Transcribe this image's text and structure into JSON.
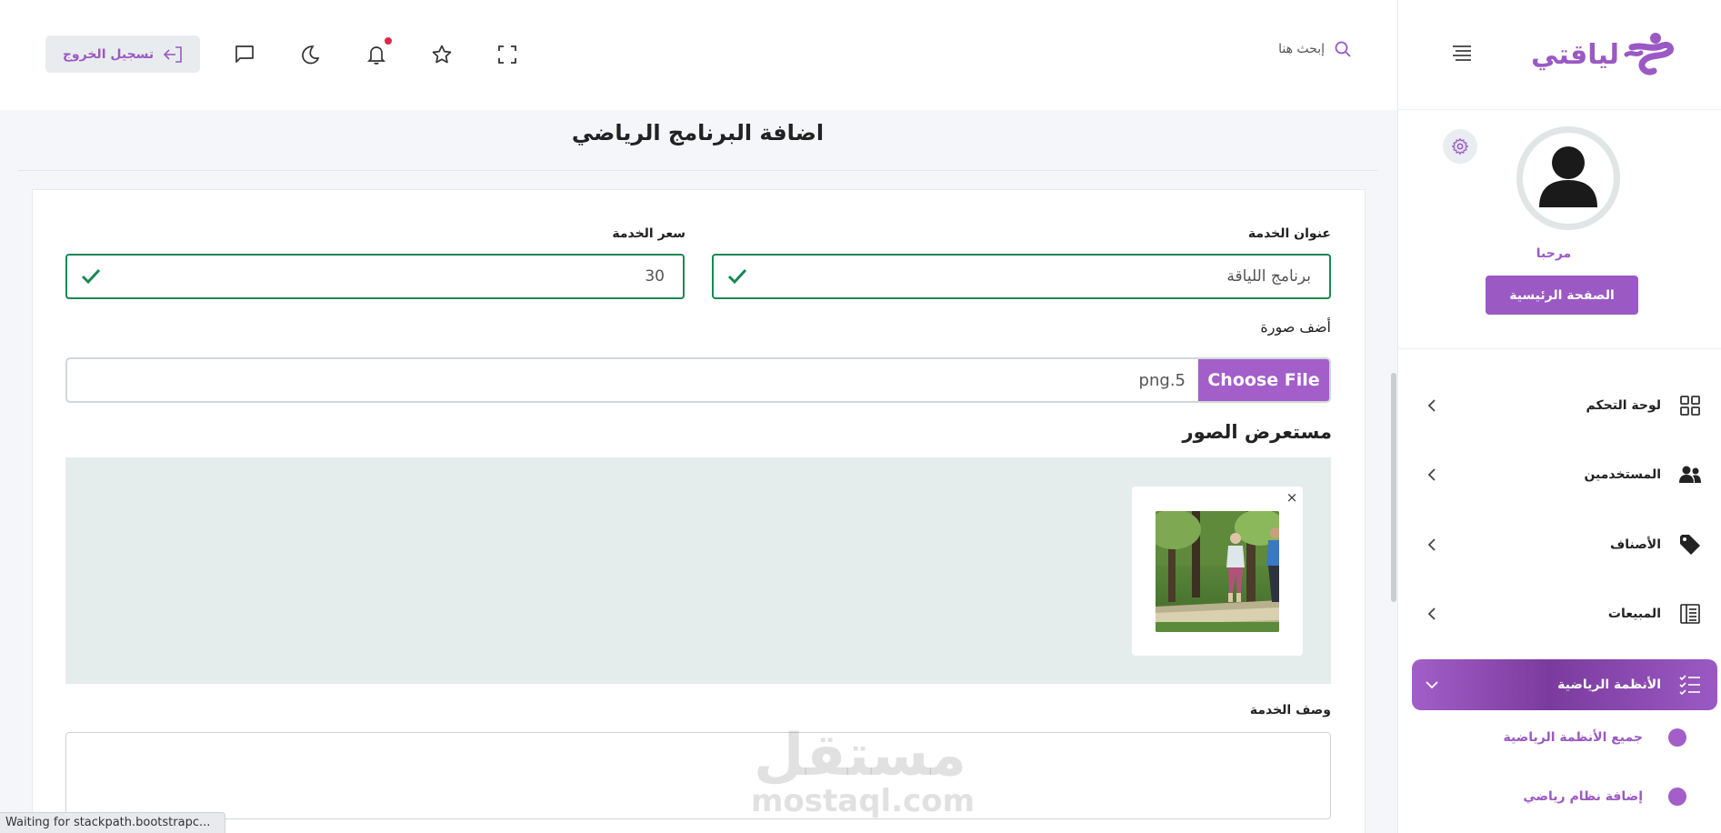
{
  "brand": {
    "name": "لياقتي",
    "color": "#9b59c4"
  },
  "header": {
    "search_placeholder": "إبحث هنا",
    "logout_label": "تسجيل الخروج",
    "icons": [
      "fullscreen-icon",
      "star-icon",
      "bell-icon",
      "moon-icon",
      "message-icon"
    ]
  },
  "profile": {
    "welcome": "مرحبا",
    "home_button": "الصفحة الرئيسية"
  },
  "sidebar": {
    "items": [
      {
        "label": "لوحة التحكم",
        "icon": "dashboard-icon"
      },
      {
        "label": "المستخدمين",
        "icon": "users-icon"
      },
      {
        "label": "الأصناف",
        "icon": "tag-icon"
      },
      {
        "label": "المبيعات",
        "icon": "sales-icon"
      },
      {
        "label": "الأنظمة الرياضية",
        "icon": "list-check-icon",
        "active": true
      }
    ],
    "subitems": [
      {
        "label": "جميع الأنظمة الرياضية"
      },
      {
        "label": "إضافة نظام رياضي"
      }
    ]
  },
  "page": {
    "title": "اضافة البرنامج الرياضي",
    "service_title_label": "عنوان الخدمة",
    "service_title_value": "برنامج اللياقة",
    "service_price_label": "سعر الخدمة",
    "service_price_value": "30",
    "add_image_label": "أضف صورة",
    "file_button": "Choose File",
    "file_name": "5.png",
    "viewer_title": "مستعرض الصور",
    "remove_label": "×",
    "description_label": "وصف الخدمة",
    "description_value": ""
  },
  "watermark": {
    "ar": "مستقل",
    "en": "mostaql.com"
  },
  "status_bar": "Waiting for stackpath.bootstrapc..."
}
